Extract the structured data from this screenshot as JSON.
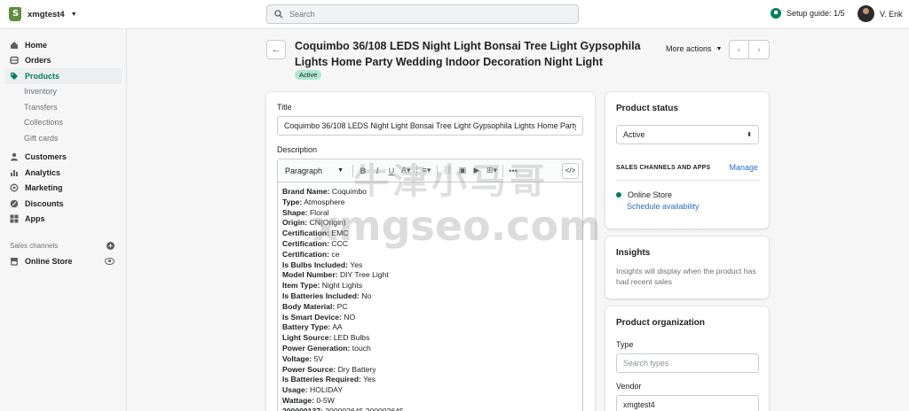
{
  "topbar": {
    "store_name": "xmgtest4",
    "search_placeholder": "Search",
    "setup_guide": "Setup guide: 1/5",
    "user_name": "V. Erik"
  },
  "sidebar": {
    "items": [
      {
        "label": "Home",
        "icon": "home-icon"
      },
      {
        "label": "Orders",
        "icon": "orders-icon"
      },
      {
        "label": "Products",
        "icon": "tag-icon",
        "active": true
      },
      {
        "label": "Customers",
        "icon": "person-icon"
      },
      {
        "label": "Analytics",
        "icon": "bar-chart-icon"
      },
      {
        "label": "Marketing",
        "icon": "target-icon"
      },
      {
        "label": "Discounts",
        "icon": "discount-icon"
      },
      {
        "label": "Apps",
        "icon": "apps-icon"
      }
    ],
    "product_subitems": [
      "Inventory",
      "Transfers",
      "Collections",
      "Gift cards"
    ],
    "sales_channels_label": "Sales channels",
    "online_store": "Online Store"
  },
  "header": {
    "title": "Coquimbo 36/108 LEDS Night Light Bonsai Tree Light Gypsophila Lights Home Party Wedding Indoor Decoration Night Light",
    "status_badge": "Active",
    "more_actions": "More actions"
  },
  "main": {
    "title_label": "Title",
    "title_value": "Coquimbo 36/108 LEDS Night Light Bonsai Tree Light Gypsophila Lights Home Party Wedding Indoor Decoration Night Light",
    "description_label": "Description",
    "paragraph_select": "Paragraph",
    "description_lines": [
      {
        "key": "Brand Name:",
        "value": "Coquimbo"
      },
      {
        "key": "Type:",
        "value": "Atmosphere"
      },
      {
        "key": "Shape:",
        "value": "Floral"
      },
      {
        "key": "Origin:",
        "value": "CN(Origin)"
      },
      {
        "key": "Certification:",
        "value": "EMC"
      },
      {
        "key": "Certification:",
        "value": "CCC"
      },
      {
        "key": "Certification:",
        "value": "ce"
      },
      {
        "key": "Is Bulbs Included:",
        "value": "Yes"
      },
      {
        "key": "Model Number:",
        "value": "DIY Tree Light"
      },
      {
        "key": "Item Type:",
        "value": "Night Lights"
      },
      {
        "key": "Is Batteries Included:",
        "value": "No"
      },
      {
        "key": "Body Material:",
        "value": "PC"
      },
      {
        "key": "Is Smart Device:",
        "value": "NO"
      },
      {
        "key": "Battery Type:",
        "value": "AA"
      },
      {
        "key": "Light Source:",
        "value": "LED Bulbs"
      },
      {
        "key": "Power Generation:",
        "value": "touch"
      },
      {
        "key": "Voltage:",
        "value": "5V"
      },
      {
        "key": "Power Source:",
        "value": "Dry Battery"
      },
      {
        "key": "Is Batteries Required:",
        "value": "Yes"
      },
      {
        "key": "Usage:",
        "value": "HOLIDAY"
      },
      {
        "key": "Wattage:",
        "value": "0-5W"
      },
      {
        "key": "200000137:",
        "value": "200002645,200002645"
      }
    ]
  },
  "status": {
    "title": "Product status",
    "selected": "Active",
    "channels_heading": "SALES CHANNELS AND APPS",
    "manage": "Manage",
    "channel": "Online Store",
    "schedule": "Schedule availability"
  },
  "insights": {
    "title": "Insights",
    "text": "Insights will display when the product has had recent sales"
  },
  "organization": {
    "title": "Product organization",
    "type_label": "Type",
    "type_placeholder": "Search types",
    "vendor_label": "Vendor",
    "vendor_value": "xmgtest4"
  },
  "watermark": {
    "line1": "牛津小马哥",
    "line2": "xmgseo.com"
  },
  "colors": {
    "accent": "#008060",
    "badge": "#aee9d1",
    "link": "#2c6ecb"
  }
}
